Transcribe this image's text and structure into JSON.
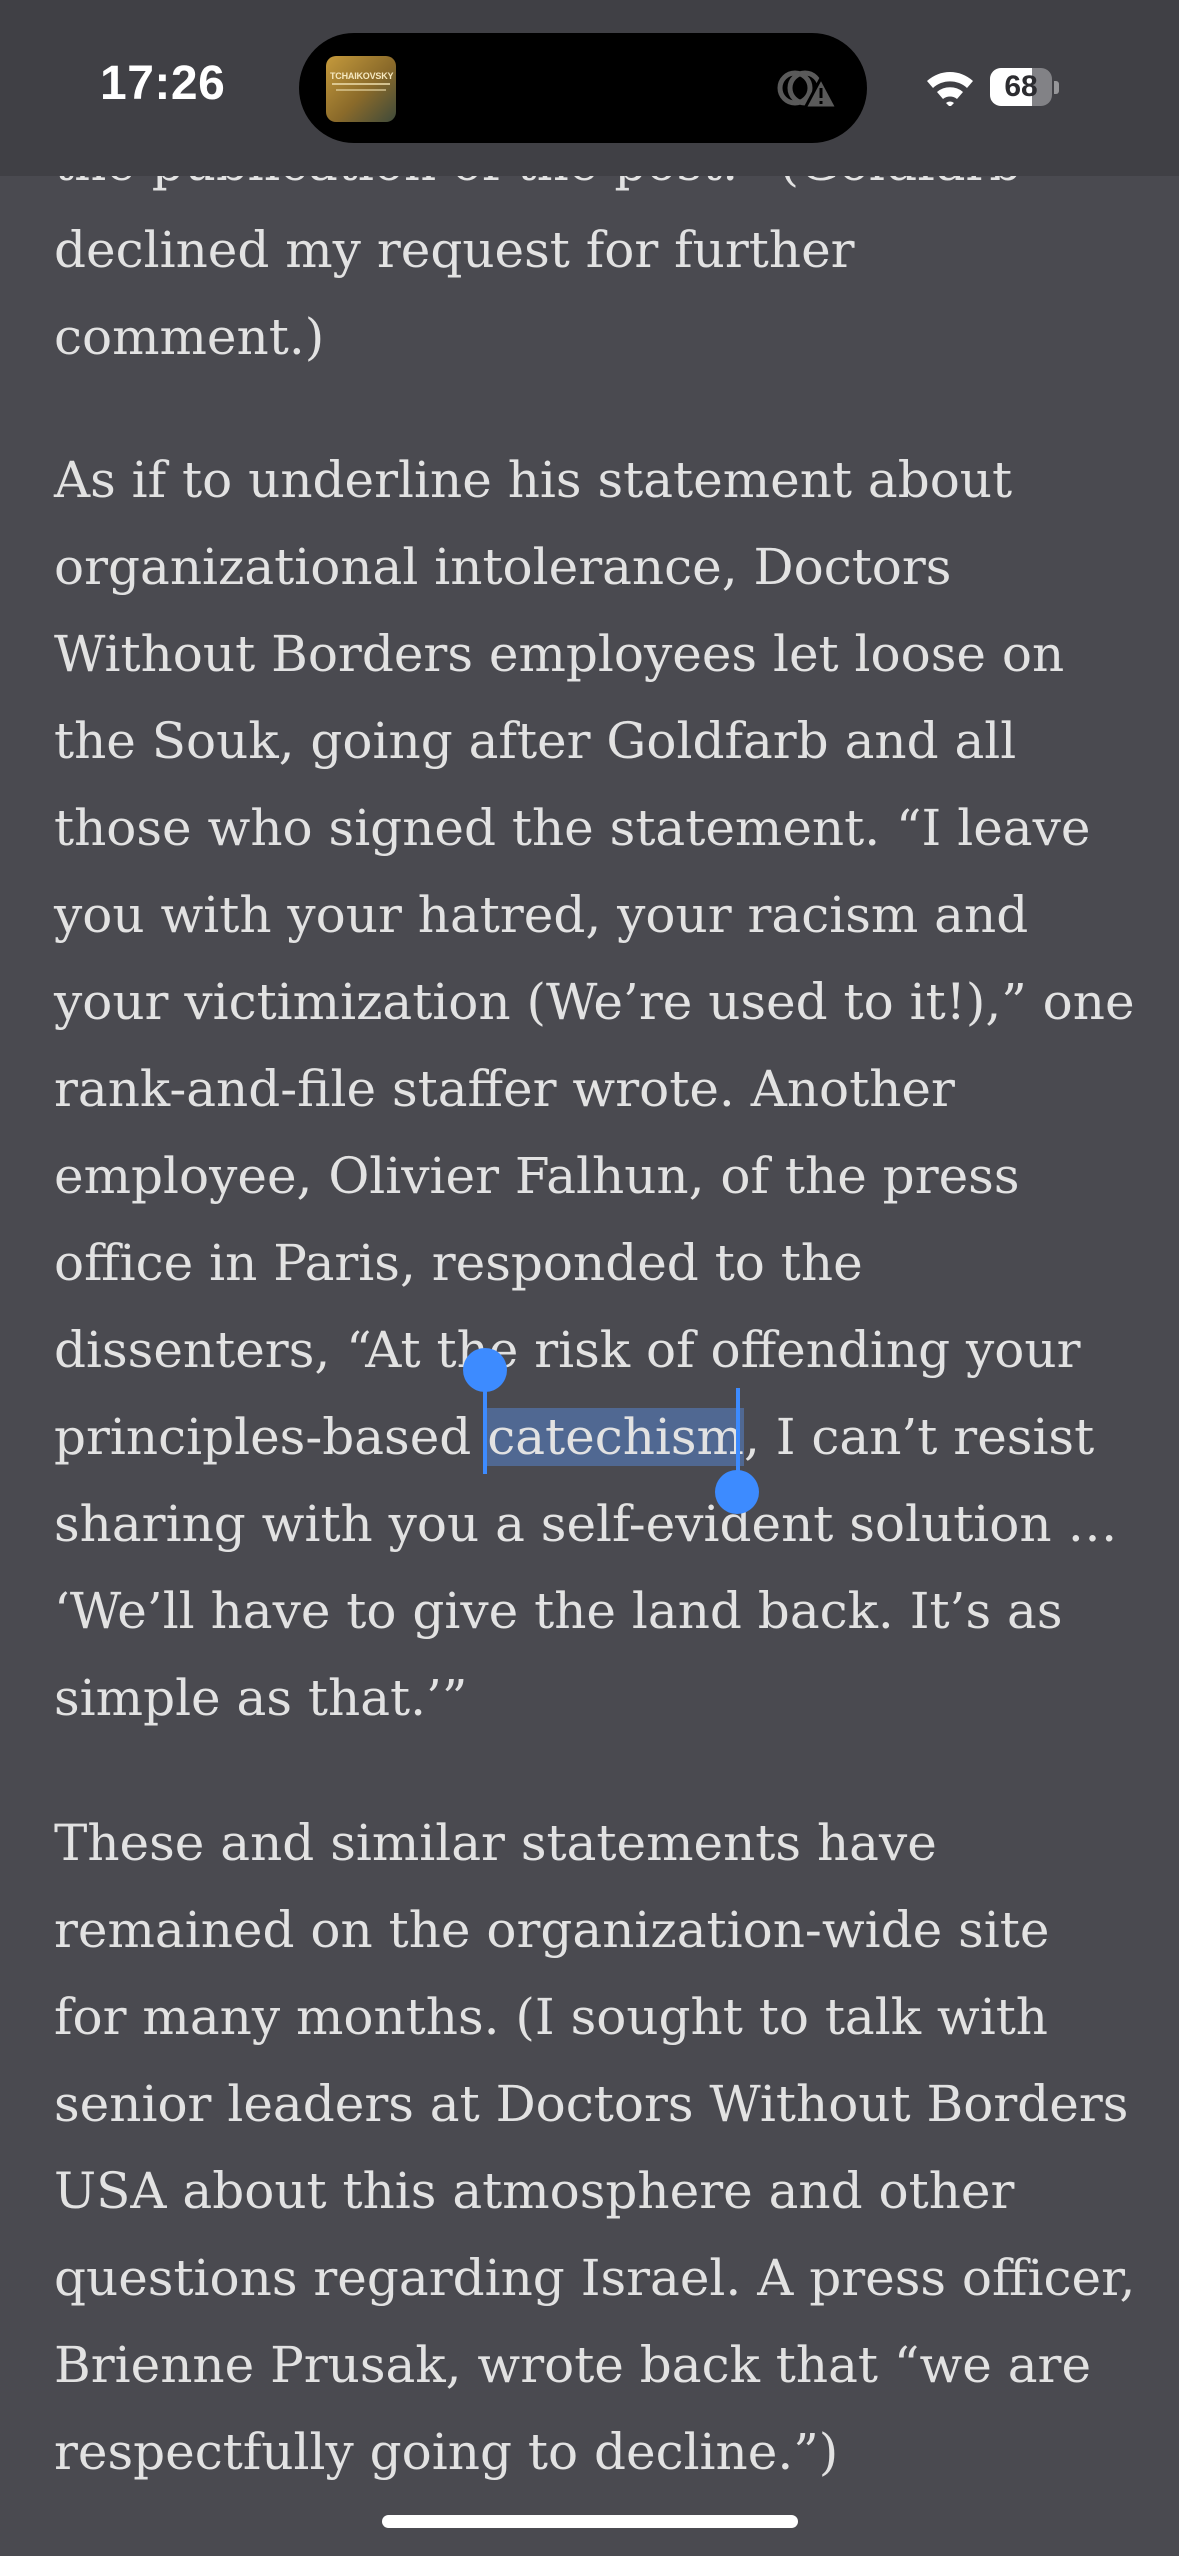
{
  "status_bar": {
    "time": "17:26",
    "battery_level": "68",
    "album_art": {
      "title": "TCHAIKOVSKY",
      "icon": "album-art-thumbnail"
    },
    "icons": [
      "alert-warning-icon",
      "wifi-icon",
      "battery-icon"
    ]
  },
  "article": {
    "paragraphs": [
      {
        "lines": [
          "the publication of the post.” (Goldfarb",
          "declined my request for further",
          "comment.)"
        ]
      },
      {
        "lines": [
          "As if to underline his statement about",
          "organizational intolerance, Doctors",
          "Without Borders employees let loose on",
          "the Souk, going after Goldfarb and all",
          "those who signed the statement. “I leave",
          "you with your hatred, your racism and",
          "your victimization (We’re used to it!),” one",
          "rank-and-file staffer wrote. Another",
          "employee, Olivier Falhun, of the press",
          "office in Paris, responded to the",
          "dissenters, “At the risk of offending your"
        ],
        "selection_line": {
          "before": "principles-based ",
          "selected": "catechism",
          "after": ", I can’t resist"
        },
        "lines_after": [
          "sharing with you a self-evident solution …",
          "‘We’ll have to give the land back. It’s as",
          "simple as that.’”"
        ]
      },
      {
        "lines": [
          "These and similar statements have",
          "remained on the organization-wide site",
          "for many months. (I sought to talk with",
          "senior leaders at Doctors Without Borders",
          "USA about this atmosphere and other",
          "questions regarding Israel. A press officer,",
          "Brienne Prusak, wrote back that “we are",
          "respectfully going to decline.”)"
        ]
      }
    ]
  },
  "colors": {
    "background": "#4a4a50",
    "text": "#e2e2e2",
    "selection": "#3d8bff"
  }
}
